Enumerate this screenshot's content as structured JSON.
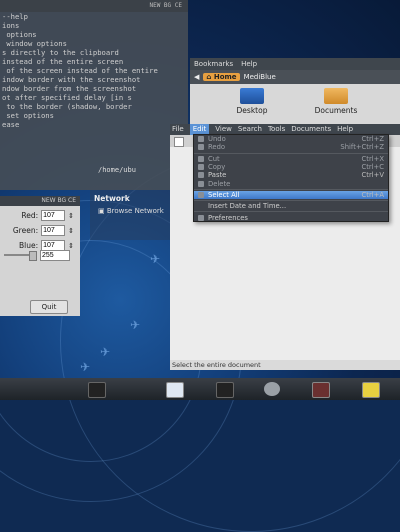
{
  "terminal": {
    "title": "NEW BG  CE",
    "lines": [
      "--help",
      "",
      "ions",
      " options",
      " window options",
      "",
      "s directly to the clipboard",
      "instead of the entire screen",
      " of the screen instead of the entire",
      "",
      "indow border with the screenshot",
      "ndow border from the screenshot",
      "ot after specified delay [in s",
      "",
      " to the border (shadow, border",
      "",
      " set options",
      "ease"
    ]
  },
  "file_manager": {
    "menu": [
      "Bookmarks",
      "Help"
    ],
    "location_home": "Home",
    "location_next": "MediBlue",
    "icons": [
      {
        "label": "Desktop"
      },
      {
        "label": "Documents"
      }
    ]
  },
  "mid_terminal_text": "/home/ubu",
  "network": {
    "header": "Network",
    "item": "Browse Network"
  },
  "color_dialog": {
    "title": "NEW BG  CE",
    "red_label": "Red:",
    "red_value": "107",
    "green_label": "Green:",
    "green_value": "107",
    "blue_label": "Blue:",
    "blue_value": "107",
    "alpha_value": "255",
    "quit_label": "Quit"
  },
  "editor": {
    "menu": [
      "File",
      "Edit",
      "View",
      "Search",
      "Tools",
      "Documents",
      "Help"
    ],
    "status": "Select the entire document"
  },
  "edit_menu": [
    {
      "label": "Undo",
      "accel": "Ctrl+Z",
      "disabled": true
    },
    {
      "label": "Redo",
      "accel": "Shift+Ctrl+Z",
      "disabled": true
    },
    {
      "label": "Cut",
      "accel": "Ctrl+X",
      "disabled": true
    },
    {
      "label": "Copy",
      "accel": "Ctrl+C",
      "disabled": true
    },
    {
      "label": "Paste",
      "accel": "Ctrl+V",
      "disabled": false
    },
    {
      "label": "Delete",
      "accel": "",
      "disabled": true
    },
    {
      "label": "Select All",
      "accel": "Ctrl+A",
      "selected": true
    },
    {
      "label": "Insert Date and Time...",
      "accel": ""
    },
    {
      "label": "Preferences",
      "accel": ""
    }
  ],
  "colors": {
    "accent": "#5b93d6",
    "desktop": "#13407c",
    "menu_bg": "#3e4249"
  }
}
